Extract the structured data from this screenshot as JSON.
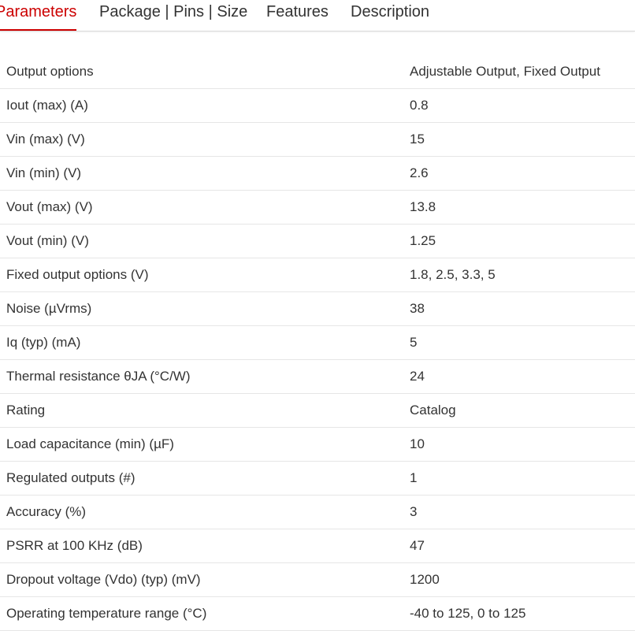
{
  "tabs": [
    {
      "label": "Parameters",
      "active": true
    },
    {
      "label": "Package | Pins | Size",
      "active": false
    },
    {
      "label": "Features",
      "active": false
    },
    {
      "label": "Description",
      "active": false
    }
  ],
  "colors": {
    "accent": "#cc0000",
    "text": "#333333",
    "divider": "#e6e6e6"
  },
  "parameters": [
    {
      "label": "Output options",
      "value": "Adjustable Output, Fixed Output"
    },
    {
      "label": "Iout (max) (A)",
      "value": "0.8"
    },
    {
      "label": "Vin (max) (V)",
      "value": "15"
    },
    {
      "label": "Vin (min) (V)",
      "value": "2.6"
    },
    {
      "label": "Vout (max) (V)",
      "value": "13.8"
    },
    {
      "label": "Vout (min) (V)",
      "value": "1.25"
    },
    {
      "label": "Fixed output options (V)",
      "value": "1.8, 2.5, 3.3, 5"
    },
    {
      "label": "Noise (µVrms)",
      "value": "38"
    },
    {
      "label": "Iq (typ) (mA)",
      "value": "5"
    },
    {
      "label": "Thermal resistance θJA (°C/W)",
      "value": "24"
    },
    {
      "label": "Rating",
      "value": "Catalog"
    },
    {
      "label": "Load capacitance (min) (µF)",
      "value": "10"
    },
    {
      "label": "Regulated outputs (#)",
      "value": "1"
    },
    {
      "label": "Accuracy (%)",
      "value": "3"
    },
    {
      "label": "PSRR at 100 KHz (dB)",
      "value": "47"
    },
    {
      "label": "Dropout voltage (Vdo) (typ) (mV)",
      "value": "1200"
    },
    {
      "label": "Operating temperature range (°C)",
      "value": "-40 to 125, 0 to 125"
    }
  ]
}
